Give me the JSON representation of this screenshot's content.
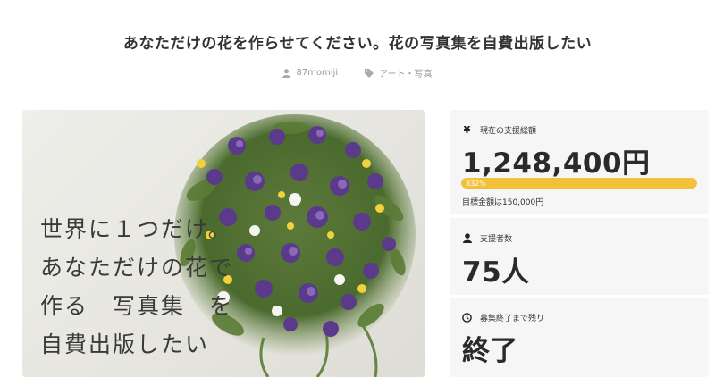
{
  "project": {
    "title": "あなただけの花を作らせてください。花の写真集を自費出版したい",
    "author": "87momiji",
    "category": "アート・写真",
    "hero_caption": "世界に１つだけ。\nあなただけの花で\n作る　写真集　を\n自費出版したい"
  },
  "stats": {
    "amount_label": "現在の支援総額",
    "amount_value": "1,248,400円",
    "progress_text": "832%",
    "progress_ratio": 1.0,
    "target_text": "目標金額は150,000円",
    "supporters_label": "支援者数",
    "supporters_value": "75人",
    "time_label": "募集終了まで残り",
    "time_value": "終了"
  },
  "icons": {
    "author": "user-icon",
    "category": "tag-icon",
    "amount": "yen-icon",
    "supporters": "user-icon",
    "time": "clock-icon"
  },
  "colors": {
    "progress": "#f3c03c",
    "panel_bg": "#f6f6f6"
  }
}
